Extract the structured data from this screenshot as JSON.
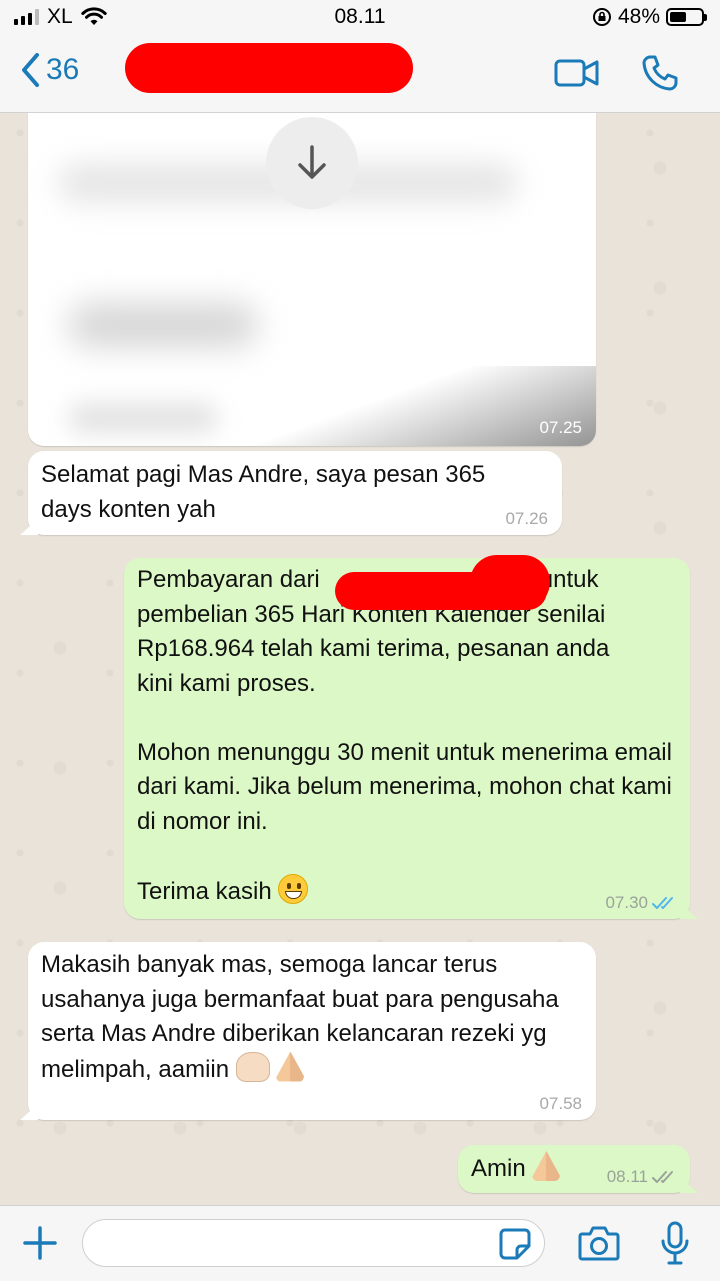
{
  "status": {
    "carrier": "XL",
    "time": "08.11",
    "battery": "48%"
  },
  "header": {
    "back_count": "36"
  },
  "messages": [
    {
      "type": "image",
      "time": "07.25"
    },
    {
      "dir": "in",
      "text": "Selamat pagi Mas Andre, saya pesan 365 days konten yah",
      "time": "07.26"
    },
    {
      "dir": "out",
      "line1_start": "Pembayaran dari",
      "line1_end": "untuk",
      "line2": "pembelian 365 Hari Konten Kalender senilai",
      "line3": "Rp168.964 telah kami terima, pesanan anda",
      "line4": "kini kami proses.",
      "para2": "Mohon menunggu 30 menit untuk menerima email dari kami. Jika belum menerima, mohon chat kami di nomor ini.",
      "para3": "Terima kasih",
      "time": "07.30"
    },
    {
      "dir": "in",
      "text": "Makasih banyak mas, semoga lancar terus usahanya juga bermanfaat buat para pengusaha serta Mas Andre diberikan kelancaran rezeki yg melimpah, aamiin",
      "time": "07.58"
    },
    {
      "dir": "out",
      "text": "Amin",
      "time": "08.11"
    }
  ],
  "colors": {
    "accent": "#1b7ab8",
    "outgoing": "#dcf8c6",
    "incoming": "#ffffff",
    "read_ticks": "#4fb6ec",
    "redaction": "#ff0000"
  },
  "icons": [
    "signal-icon",
    "wifi-icon",
    "orientation-lock-icon",
    "battery-icon",
    "back-chevron-icon",
    "video-call-icon",
    "phone-icon",
    "download-arrow-icon",
    "double-check-icon",
    "plus-icon",
    "sticker-icon",
    "camera-icon",
    "microphone-icon"
  ]
}
